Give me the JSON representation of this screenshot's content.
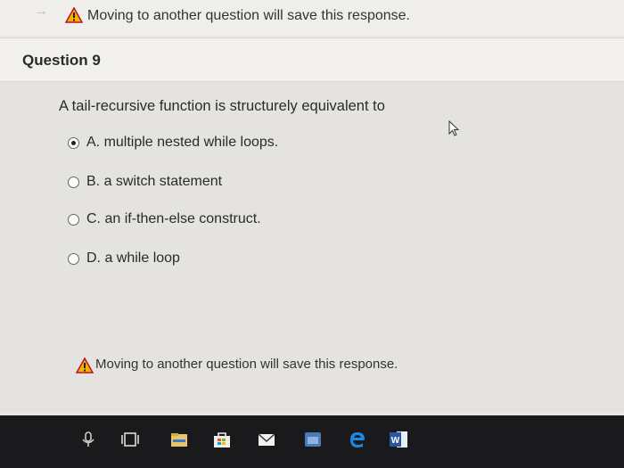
{
  "top_banner": {
    "warning_text": "Moving to another question will save this response."
  },
  "question": {
    "title": "Question 9",
    "prompt": "A tail-recursive function is structurely equivalent to",
    "options": [
      {
        "label": "A. multiple nested while loops.",
        "selected": true
      },
      {
        "label": "B. a switch statement",
        "selected": false
      },
      {
        "label": "C. an if-then-else construct.",
        "selected": false
      },
      {
        "label": "D. a while loop",
        "selected": false
      }
    ]
  },
  "bottom_banner": {
    "warning_text": "Moving to another question will save this response."
  },
  "taskbar": {
    "icons": [
      "microphone-icon",
      "task-view-icon",
      "file-explorer-icon",
      "store-icon",
      "mail-icon",
      "calendar-icon",
      "edge-browser-icon",
      "word-app-icon"
    ]
  },
  "colors": {
    "warning": "#f0b400",
    "taskbar": "#1a1a1c"
  }
}
